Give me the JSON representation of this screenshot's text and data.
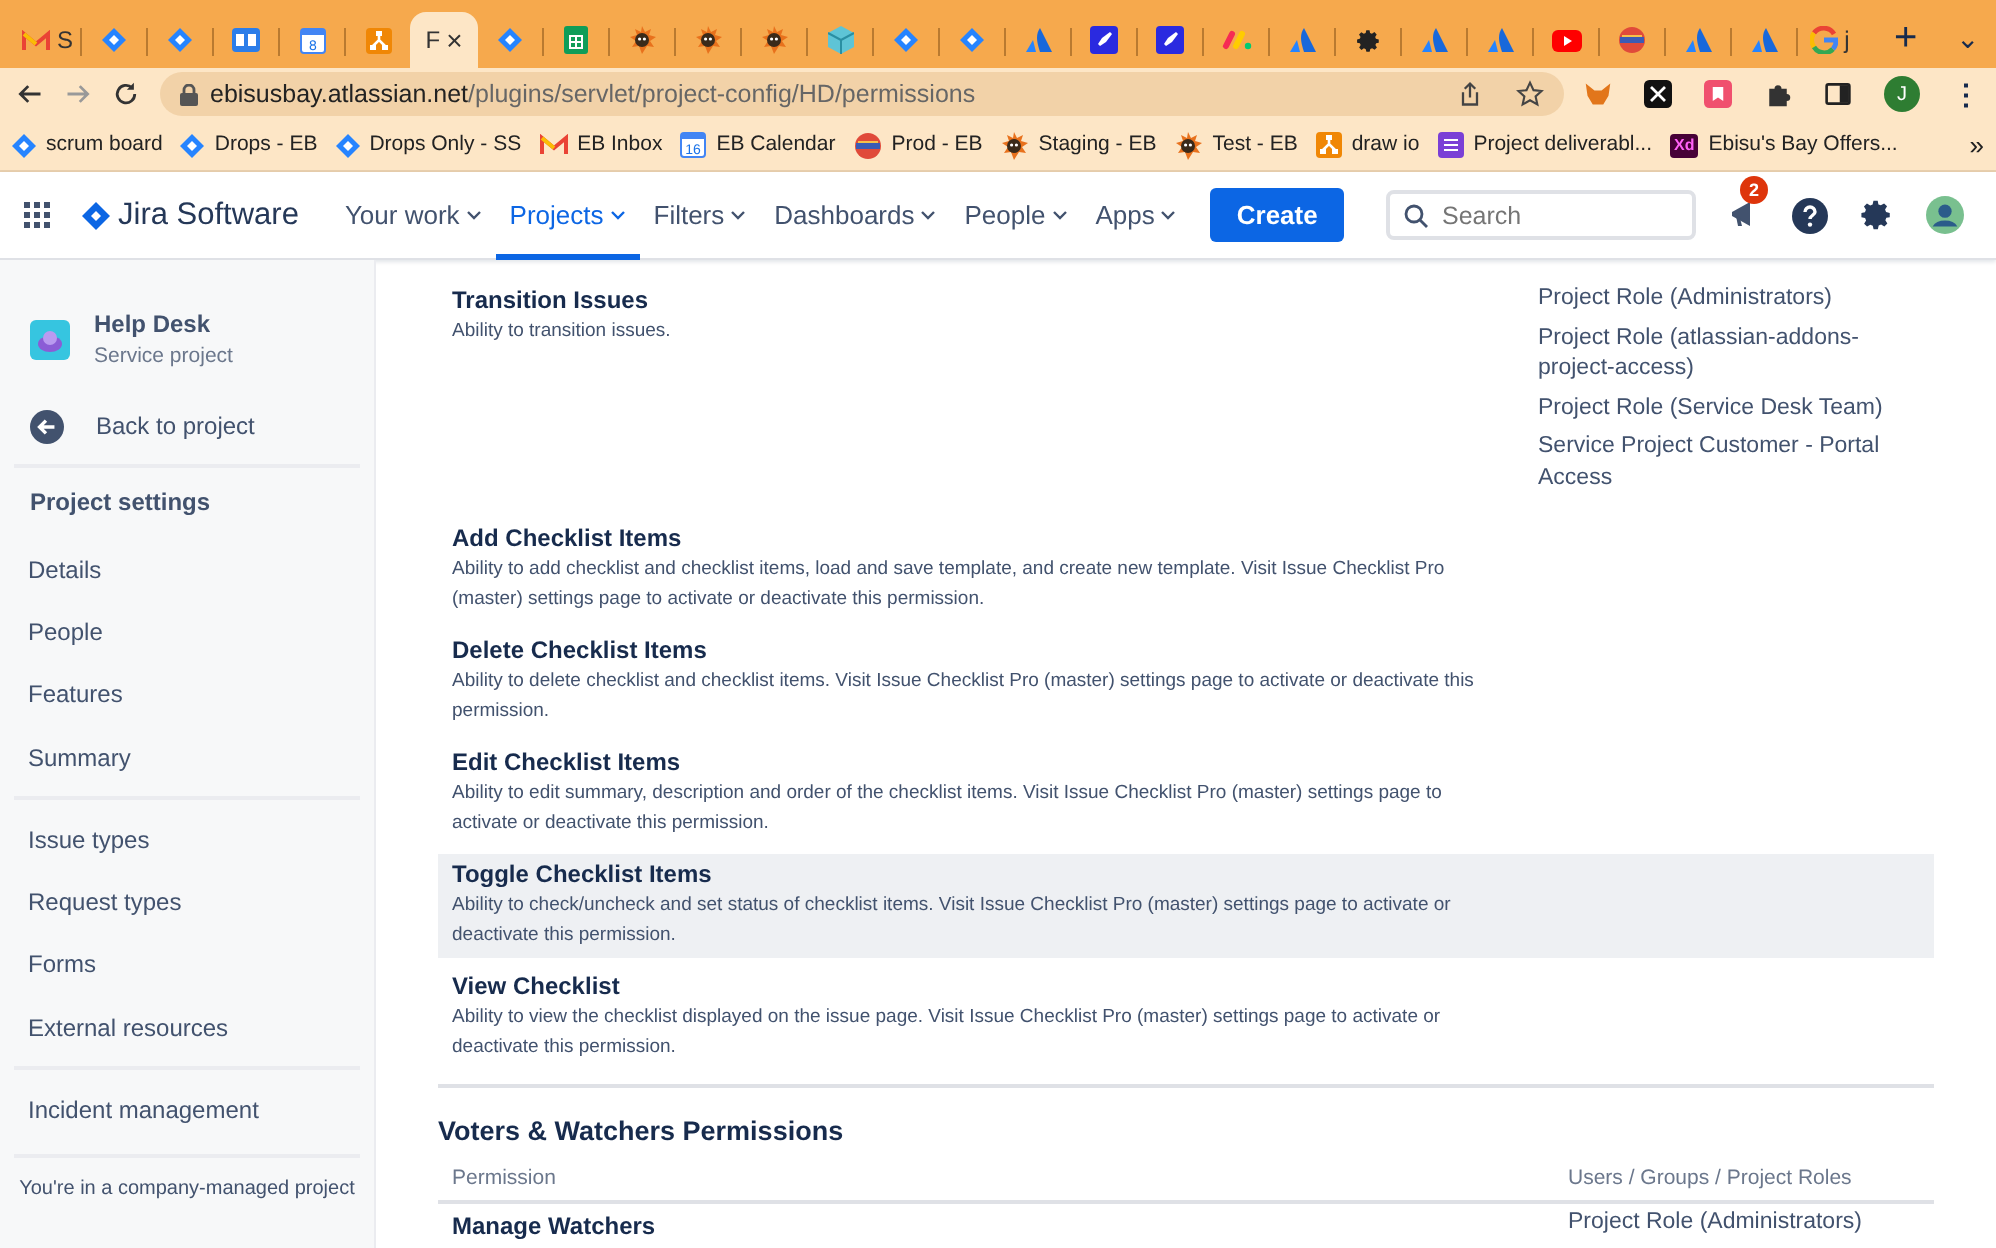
{
  "browser": {
    "tabs": [
      {
        "kind": "gmail",
        "label": "S",
        "selected": false
      },
      {
        "kind": "jira",
        "selected": false
      },
      {
        "kind": "jira",
        "selected": false
      },
      {
        "kind": "book",
        "selected": false
      },
      {
        "kind": "calendar",
        "day": "8",
        "selected": false
      },
      {
        "kind": "drawio",
        "selected": false
      },
      {
        "kind": "page",
        "label": "F",
        "selected": true
      },
      {
        "kind": "jira",
        "selected": false
      },
      {
        "kind": "sheets",
        "selected": false
      },
      {
        "kind": "bug",
        "selected": false
      },
      {
        "kind": "bug",
        "selected": false
      },
      {
        "kind": "bug",
        "selected": false
      },
      {
        "kind": "cube",
        "selected": false
      },
      {
        "kind": "jira",
        "selected": false
      },
      {
        "kind": "jira",
        "selected": false
      },
      {
        "kind": "atlassian",
        "selected": false
      },
      {
        "kind": "rocket",
        "selected": false
      },
      {
        "kind": "rocket",
        "selected": false
      },
      {
        "kind": "monday",
        "selected": false
      },
      {
        "kind": "atlassian",
        "selected": false
      },
      {
        "kind": "gear",
        "selected": false
      },
      {
        "kind": "atlassian",
        "selected": false
      },
      {
        "kind": "atlassian",
        "selected": false
      },
      {
        "kind": "youtube",
        "selected": false
      },
      {
        "kind": "bowl",
        "selected": false
      },
      {
        "kind": "atlassian",
        "selected": false
      },
      {
        "kind": "atlassian",
        "selected": false
      },
      {
        "kind": "google",
        "label": "j",
        "selected": false
      }
    ],
    "tab_close": "×",
    "new_tab": "+",
    "tab_menu": "⌄",
    "url_domain": "ebisusbay.atlassian.net",
    "url_path": "/plugins/servlet/project-config/HD/permissions",
    "profile": "J",
    "menu": "⋮",
    "bookmarks": [
      {
        "kind": "jira",
        "label": "scrum board"
      },
      {
        "kind": "jira",
        "label": "Drops - EB"
      },
      {
        "kind": "jira",
        "label": "Drops Only - SS"
      },
      {
        "kind": "gmail",
        "label": "EB Inbox"
      },
      {
        "kind": "calendar",
        "day": "16",
        "label": "EB Calendar"
      },
      {
        "kind": "bowl",
        "label": "Prod - EB"
      },
      {
        "kind": "bug",
        "label": "Staging - EB"
      },
      {
        "kind": "bug",
        "label": "Test - EB"
      },
      {
        "kind": "drawio",
        "label": "draw io"
      },
      {
        "kind": "list",
        "label": "Project deliverabl..."
      },
      {
        "kind": "xd",
        "badge": "Xd",
        "label": "Ebisu's Bay Offers..."
      }
    ],
    "bookmarks_more": "»"
  },
  "topnav": {
    "product": "Jira Software",
    "items": [
      {
        "label": "Your work",
        "selected": false
      },
      {
        "label": "Projects",
        "selected": true
      },
      {
        "label": "Filters",
        "selected": false
      },
      {
        "label": "Dashboards",
        "selected": false
      },
      {
        "label": "People",
        "selected": false
      },
      {
        "label": "Apps",
        "selected": false
      }
    ],
    "create": "Create",
    "search": {
      "placeholder": "Search"
    },
    "notifications": "2"
  },
  "sidebar": {
    "project": "Help Desk",
    "project_type": "Service project",
    "back": "Back to project",
    "heading": "Project settings",
    "groups": [
      [
        {
          "label": "Details"
        },
        {
          "label": "People"
        },
        {
          "label": "Features"
        },
        {
          "label": "Summary"
        }
      ],
      [
        {
          "label": "Issue types"
        },
        {
          "label": "Request types"
        },
        {
          "label": "Forms"
        },
        {
          "label": "External resources"
        }
      ],
      [
        {
          "label": "Incident management"
        }
      ]
    ],
    "footer": "You're in a company-managed project"
  },
  "permissions": [
    {
      "name": "Transition Issues",
      "description": "Ability to transition issues.",
      "highlighted": false,
      "roles": [
        "Project Role (Administrators)",
        "Project Role (atlassian-addons-project-access)",
        "Project Role (Service Desk Team)",
        "Service Project Customer - Portal Access"
      ]
    },
    {
      "name": "Add Checklist Items",
      "description": "Ability to add checklist and checklist items, load and save template, and create new template. Visit Issue Checklist Pro (master) settings page to activate or deactivate this permission.",
      "highlighted": false
    },
    {
      "name": "Delete Checklist Items",
      "description": "Ability to delete checklist and checklist items. Visit Issue Checklist Pro (master) settings page to activate or deactivate this permission.",
      "highlighted": false
    },
    {
      "name": "Edit Checklist Items",
      "description": "Ability to edit summary, description and order of the checklist items. Visit Issue Checklist Pro (master) settings page to activate or deactivate this permission.",
      "highlighted": false
    },
    {
      "name": "Toggle Checklist Items",
      "description": "Ability to check/uncheck and set status of checklist items. Visit Issue Checklist Pro (master) settings page to activate or deactivate this permission.",
      "highlighted": true
    },
    {
      "name": "View Checklist",
      "description": "Ability to view the checklist displayed on the issue page. Visit Issue Checklist Pro (master) settings page to activate or deactivate this permission.",
      "highlighted": false
    }
  ],
  "voters_section": {
    "title": "Voters & Watchers Permissions",
    "columns": [
      "Permission",
      "Users / Groups / Project Roles"
    ],
    "rows": [
      {
        "name": "Manage Watchers",
        "roles": [
          "Project Role (Administrators)"
        ]
      }
    ]
  }
}
